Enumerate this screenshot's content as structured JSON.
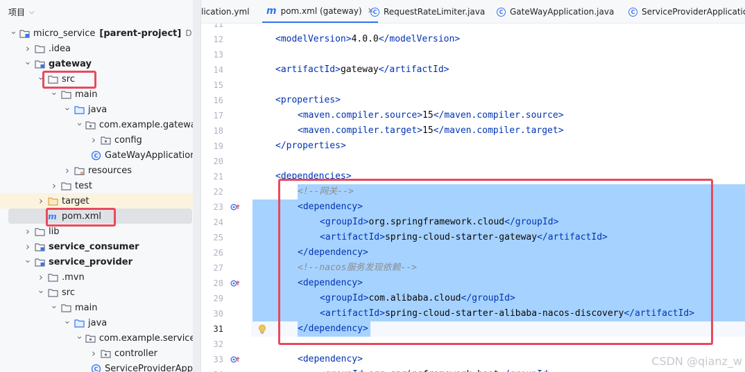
{
  "panel": {
    "title": "项目",
    "tree": [
      {
        "label": "micro_service",
        "hint": "[parent-project]",
        "path": "D:\\micr",
        "type": "module",
        "arrow": "down",
        "depth": 0,
        "bold": false
      },
      {
        "label": ".idea",
        "type": "folder",
        "arrow": "right",
        "depth": 1
      },
      {
        "label": "gateway",
        "type": "module",
        "arrow": "down",
        "depth": 1,
        "bold": true
      },
      {
        "label": "src",
        "type": "folder",
        "arrow": "down",
        "depth": 2
      },
      {
        "label": "main",
        "type": "folder",
        "arrow": "down",
        "depth": 3
      },
      {
        "label": "java",
        "type": "src-folder",
        "arrow": "down",
        "depth": 4
      },
      {
        "label": "com.example.gateway",
        "type": "package",
        "arrow": "down",
        "depth": 5
      },
      {
        "label": "config",
        "type": "package",
        "arrow": "right",
        "depth": 6
      },
      {
        "label": "GateWayApplication",
        "type": "class",
        "arrow": "",
        "depth": 6
      },
      {
        "label": "resources",
        "type": "res-folder",
        "arrow": "right",
        "depth": 4
      },
      {
        "label": "test",
        "type": "folder",
        "arrow": "right",
        "depth": 3
      },
      {
        "label": "target",
        "type": "target-folder",
        "arrow": "right",
        "depth": 2,
        "highlight": true
      },
      {
        "label": "pom.xml",
        "type": "maven",
        "arrow": "",
        "depth": 2,
        "selected": true
      },
      {
        "label": "lib",
        "type": "folder",
        "arrow": "right",
        "depth": 1
      },
      {
        "label": "service_consumer",
        "type": "module",
        "arrow": "right",
        "depth": 1,
        "bold": true
      },
      {
        "label": "service_provider",
        "type": "module",
        "arrow": "down",
        "depth": 1,
        "bold": true
      },
      {
        "label": ".mvn",
        "type": "folder",
        "arrow": "right",
        "depth": 2
      },
      {
        "label": "src",
        "type": "folder",
        "arrow": "down",
        "depth": 2
      },
      {
        "label": "main",
        "type": "folder",
        "arrow": "down",
        "depth": 3
      },
      {
        "label": "java",
        "type": "src-folder",
        "arrow": "down",
        "depth": 4
      },
      {
        "label": "com.example.service_p",
        "type": "package",
        "arrow": "down",
        "depth": 5
      },
      {
        "label": "controller",
        "type": "package",
        "arrow": "right",
        "depth": 6
      },
      {
        "label": "ServiceProviderApp",
        "type": "class",
        "arrow": "",
        "depth": 6
      }
    ]
  },
  "tabs": [
    {
      "label": "lication.yml",
      "icon": "",
      "active": false
    },
    {
      "label": "pom.xml (gateway)",
      "icon": "maven",
      "active": true,
      "closable": true
    },
    {
      "label": "RequestRateLimiter.java",
      "icon": "class",
      "active": false
    },
    {
      "label": "GateWayApplication.java",
      "icon": "class",
      "active": false
    },
    {
      "label": "ServiceProviderApplication",
      "icon": "class",
      "active": false
    }
  ],
  "editor": {
    "lines": [
      {
        "n": "11",
        "indent": 1,
        "parts": []
      },
      {
        "n": "12",
        "indent": 1,
        "parts": [
          [
            "tg",
            "<"
          ],
          [
            "tg",
            "modelVersion"
          ],
          [
            "tg",
            ">"
          ],
          [
            "tx",
            "4.0.0"
          ],
          [
            "tg",
            "</"
          ],
          [
            "tg",
            "modelVersion"
          ],
          [
            "tg",
            ">"
          ]
        ]
      },
      {
        "n": "13",
        "indent": 1,
        "parts": []
      },
      {
        "n": "14",
        "indent": 1,
        "parts": [
          [
            "tg",
            "<"
          ],
          [
            "tg",
            "artifactId"
          ],
          [
            "tg",
            ">"
          ],
          [
            "tx",
            "gateway"
          ],
          [
            "tg",
            "</"
          ],
          [
            "tg",
            "artifactId"
          ],
          [
            "tg",
            ">"
          ]
        ]
      },
      {
        "n": "15",
        "indent": 1,
        "parts": []
      },
      {
        "n": "16",
        "indent": 1,
        "parts": [
          [
            "tg",
            "<"
          ],
          [
            "tg",
            "properties"
          ],
          [
            "tg",
            ">"
          ]
        ]
      },
      {
        "n": "17",
        "indent": 2,
        "parts": [
          [
            "tg",
            "<"
          ],
          [
            "tg",
            "maven.compiler.source"
          ],
          [
            "tg",
            ">"
          ],
          [
            "tx",
            "15"
          ],
          [
            "tg",
            "</"
          ],
          [
            "tg",
            "maven.compiler.source"
          ],
          [
            "tg",
            ">"
          ]
        ]
      },
      {
        "n": "18",
        "indent": 2,
        "parts": [
          [
            "tg",
            "<"
          ],
          [
            "tg",
            "maven.compiler.target"
          ],
          [
            "tg",
            ">"
          ],
          [
            "tx",
            "15"
          ],
          [
            "tg",
            "</"
          ],
          [
            "tg",
            "maven.compiler.target"
          ],
          [
            "tg",
            ">"
          ]
        ]
      },
      {
        "n": "19",
        "indent": 1,
        "parts": [
          [
            "tg",
            "</"
          ],
          [
            "tg",
            "properties"
          ],
          [
            "tg",
            ">"
          ]
        ]
      },
      {
        "n": "20",
        "indent": 1,
        "parts": []
      },
      {
        "n": "21",
        "indent": 1,
        "parts": [
          [
            "tg",
            "<"
          ],
          [
            "tg",
            "dependencies"
          ],
          [
            "tg",
            ">"
          ]
        ]
      },
      {
        "n": "22",
        "indent": 2,
        "parts": [
          [
            "cm",
            "<!--网关-->"
          ]
        ],
        "selected": true
      },
      {
        "n": "23",
        "indent": 2,
        "parts": [
          [
            "tg",
            "<"
          ],
          [
            "tg",
            "dependency"
          ],
          [
            "tg",
            ">"
          ]
        ],
        "selected": true,
        "mark": true
      },
      {
        "n": "24",
        "indent": 3,
        "parts": [
          [
            "tg",
            "<"
          ],
          [
            "tg",
            "groupId"
          ],
          [
            "tg",
            ">"
          ],
          [
            "tx",
            "org.springframework.cloud"
          ],
          [
            "tg",
            "</"
          ],
          [
            "tg",
            "groupId"
          ],
          [
            "tg",
            ">"
          ]
        ],
        "selected": true
      },
      {
        "n": "25",
        "indent": 3,
        "parts": [
          [
            "tg",
            "<"
          ],
          [
            "tg",
            "artifactId"
          ],
          [
            "tg",
            ">"
          ],
          [
            "tx",
            "spring-cloud-starter-gateway"
          ],
          [
            "tg",
            "</"
          ],
          [
            "tg",
            "artifactId"
          ],
          [
            "tg",
            ">"
          ]
        ],
        "selected": true
      },
      {
        "n": "26",
        "indent": 2,
        "parts": [
          [
            "tg",
            "</"
          ],
          [
            "tg",
            "dependency"
          ],
          [
            "tg",
            ">"
          ]
        ],
        "selected": true
      },
      {
        "n": "27",
        "indent": 2,
        "parts": [
          [
            "cm",
            "<!--nacos服务发现依赖-->"
          ]
        ],
        "selected": true
      },
      {
        "n": "28",
        "indent": 2,
        "parts": [
          [
            "tg",
            "<"
          ],
          [
            "tg",
            "dependency"
          ],
          [
            "tg",
            ">"
          ]
        ],
        "selected": true,
        "mark": true
      },
      {
        "n": "29",
        "indent": 3,
        "parts": [
          [
            "tg",
            "<"
          ],
          [
            "tg",
            "groupId"
          ],
          [
            "tg",
            ">"
          ],
          [
            "tx",
            "com.alibaba.cloud"
          ],
          [
            "tg",
            "</"
          ],
          [
            "tg",
            "groupId"
          ],
          [
            "tg",
            ">"
          ]
        ],
        "selected": true
      },
      {
        "n": "30",
        "indent": 3,
        "parts": [
          [
            "tg",
            "<"
          ],
          [
            "tg",
            "artifactId"
          ],
          [
            "tg",
            ">"
          ],
          [
            "tx",
            "spring-cloud-starter-alibaba-nacos-discovery"
          ],
          [
            "tg",
            "</"
          ],
          [
            "tg",
            "artifactId"
          ],
          [
            "tg",
            ">"
          ]
        ],
        "selected": true
      },
      {
        "n": "31",
        "indent": 2,
        "parts": [
          [
            "tg",
            "</"
          ],
          [
            "tg",
            "dependency"
          ],
          [
            "tg",
            ">"
          ]
        ],
        "selected": true,
        "current": true,
        "bulb": true
      },
      {
        "n": "32",
        "indent": 1,
        "parts": []
      },
      {
        "n": "33",
        "indent": 2,
        "parts": [
          [
            "tg",
            "<"
          ],
          [
            "tg",
            "dependency"
          ],
          [
            "tg",
            ">"
          ]
        ],
        "mark": true
      },
      {
        "n": "34",
        "indent": 3,
        "parts": [
          [
            "tg",
            "<"
          ],
          [
            "tg",
            "groupId"
          ],
          [
            "tg",
            ">"
          ],
          [
            "tx",
            "org.springframework.boot"
          ],
          [
            "tg",
            "</"
          ],
          [
            "tg",
            "groupId"
          ],
          [
            "tg",
            ">"
          ]
        ]
      }
    ]
  },
  "watermark": "CSDN @qianz_w"
}
